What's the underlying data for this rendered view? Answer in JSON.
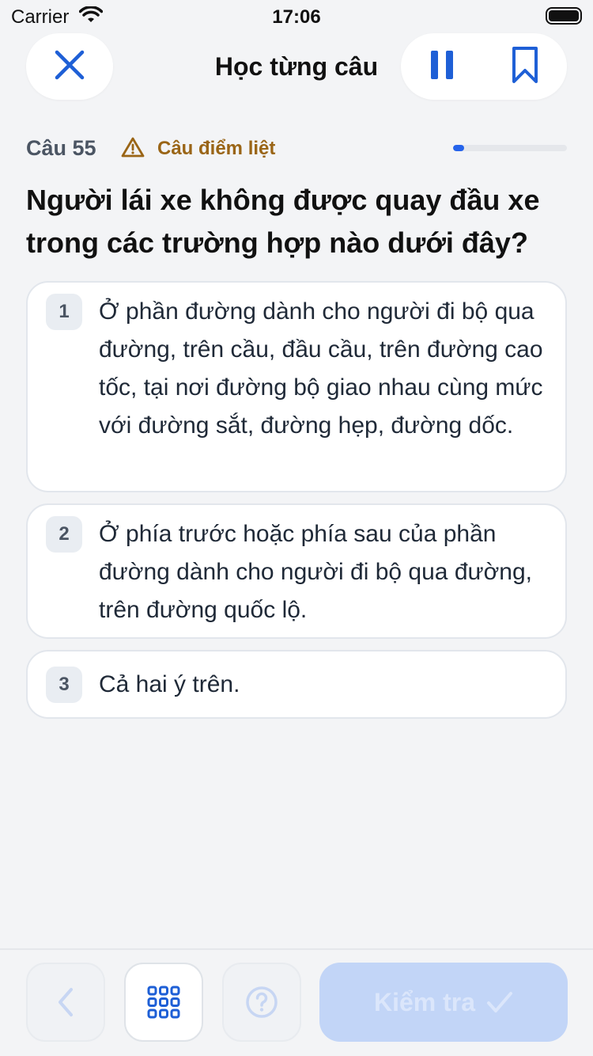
{
  "status_bar": {
    "carrier": "Carrier",
    "time": "17:06"
  },
  "header": {
    "title": "Học từng câu"
  },
  "question": {
    "number_label": "Câu 55",
    "tag": "Câu điểm liệt",
    "progress_fraction": 0.1,
    "text": "Người lái xe không được quay đầu xe trong các trường hợp nào dưới đây?"
  },
  "answers": [
    {
      "index": "1",
      "text": "Ở phần đường dành cho người đi bộ qua đường, trên cầu, đầu cầu, trên đường cao tốc, tại nơi đường bộ giao nhau cùng mức với đường sắt, đường hẹp, đường dốc."
    },
    {
      "index": "2",
      "text": "Ở phía trước hoặc phía sau của phần đường dành cho người đi bộ qua đường, trên đường quốc lộ."
    },
    {
      "index": "3",
      "text": "Cả hai ý trên."
    }
  ],
  "bottom": {
    "check_label": "Kiểm tra"
  },
  "colors": {
    "accent": "#2563eb",
    "warning": "#9a6516",
    "background": "#f3f4f6"
  },
  "icons": [
    "close-icon",
    "pause-icon",
    "bookmark-icon",
    "warning-icon",
    "chevron-left-icon",
    "grid-icon",
    "help-icon",
    "checkmark-icon"
  ]
}
